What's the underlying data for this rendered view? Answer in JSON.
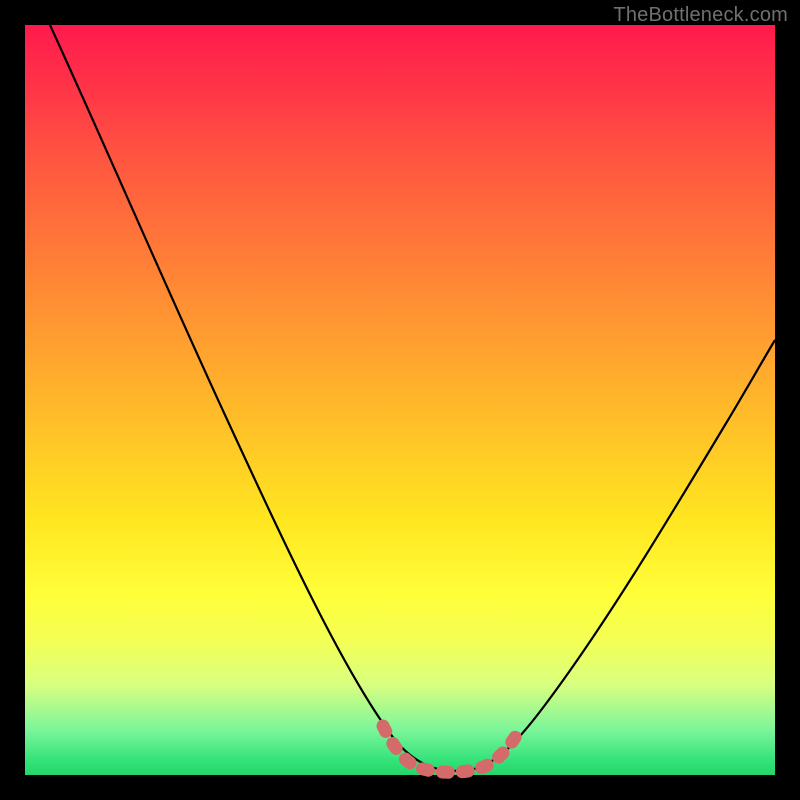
{
  "watermark": "TheBottleneck.com",
  "colors": {
    "background": "#000000",
    "gradient_top": "#ff1a4d",
    "gradient_mid": "#ffe620",
    "gradient_bottom": "#24d66a",
    "curve": "#000000",
    "marker": "#d46a6a"
  },
  "chart_data": {
    "type": "line",
    "title": "",
    "xlabel": "",
    "ylabel": "",
    "xlim": [
      0,
      100
    ],
    "ylim": [
      0,
      100
    ],
    "series": [
      {
        "name": "bottleneck-curve",
        "x": [
          0,
          5,
          10,
          15,
          20,
          25,
          30,
          35,
          40,
          45,
          50,
          52,
          55,
          58,
          60,
          63,
          65,
          70,
          75,
          80,
          85,
          90,
          95,
          100
        ],
        "values": [
          100,
          93,
          85,
          77,
          69,
          60,
          51,
          42,
          32,
          21,
          9,
          5,
          2,
          1,
          1,
          2,
          4,
          10,
          18,
          26,
          34,
          42,
          49,
          57
        ]
      },
      {
        "name": "optimal-range-marker",
        "x": [
          50,
          52,
          55,
          58,
          60,
          63,
          65
        ],
        "values": [
          9,
          5,
          2,
          1,
          1,
          2,
          4
        ]
      }
    ],
    "annotations": []
  }
}
